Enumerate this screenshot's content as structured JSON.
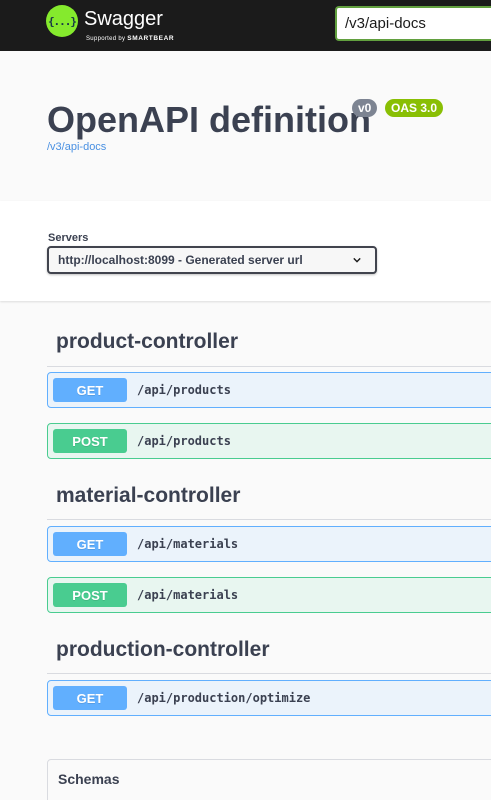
{
  "topbar": {
    "brand": "Swagger",
    "tagline_prefix": "Supported by",
    "tagline_brand": "SMARTBEAR",
    "logo_glyph": "{...}",
    "url_value": "/v3/api-docs",
    "accent": "#85ea2d"
  },
  "info": {
    "title": "OpenAPI definition",
    "version_badge": "v0",
    "oas_badge": "OAS 3.0",
    "spec_link": "/v3/api-docs"
  },
  "servers": {
    "label": "Servers",
    "selected": "http://localhost:8099 - Generated server url"
  },
  "tags": [
    {
      "name": "product-controller",
      "operations": [
        {
          "method": "GET",
          "path": "/api/products"
        },
        {
          "method": "POST",
          "path": "/api/products"
        }
      ]
    },
    {
      "name": "material-controller",
      "operations": [
        {
          "method": "GET",
          "path": "/api/materials"
        },
        {
          "method": "POST",
          "path": "/api/materials"
        }
      ]
    },
    {
      "name": "production-controller",
      "operations": [
        {
          "method": "GET",
          "path": "/api/production/optimize"
        }
      ]
    }
  ],
  "schemas": {
    "title": "Schemas"
  },
  "colors": {
    "get": "#61affe",
    "post": "#49cc90",
    "text": "#3b4151",
    "link": "#4990e2"
  }
}
